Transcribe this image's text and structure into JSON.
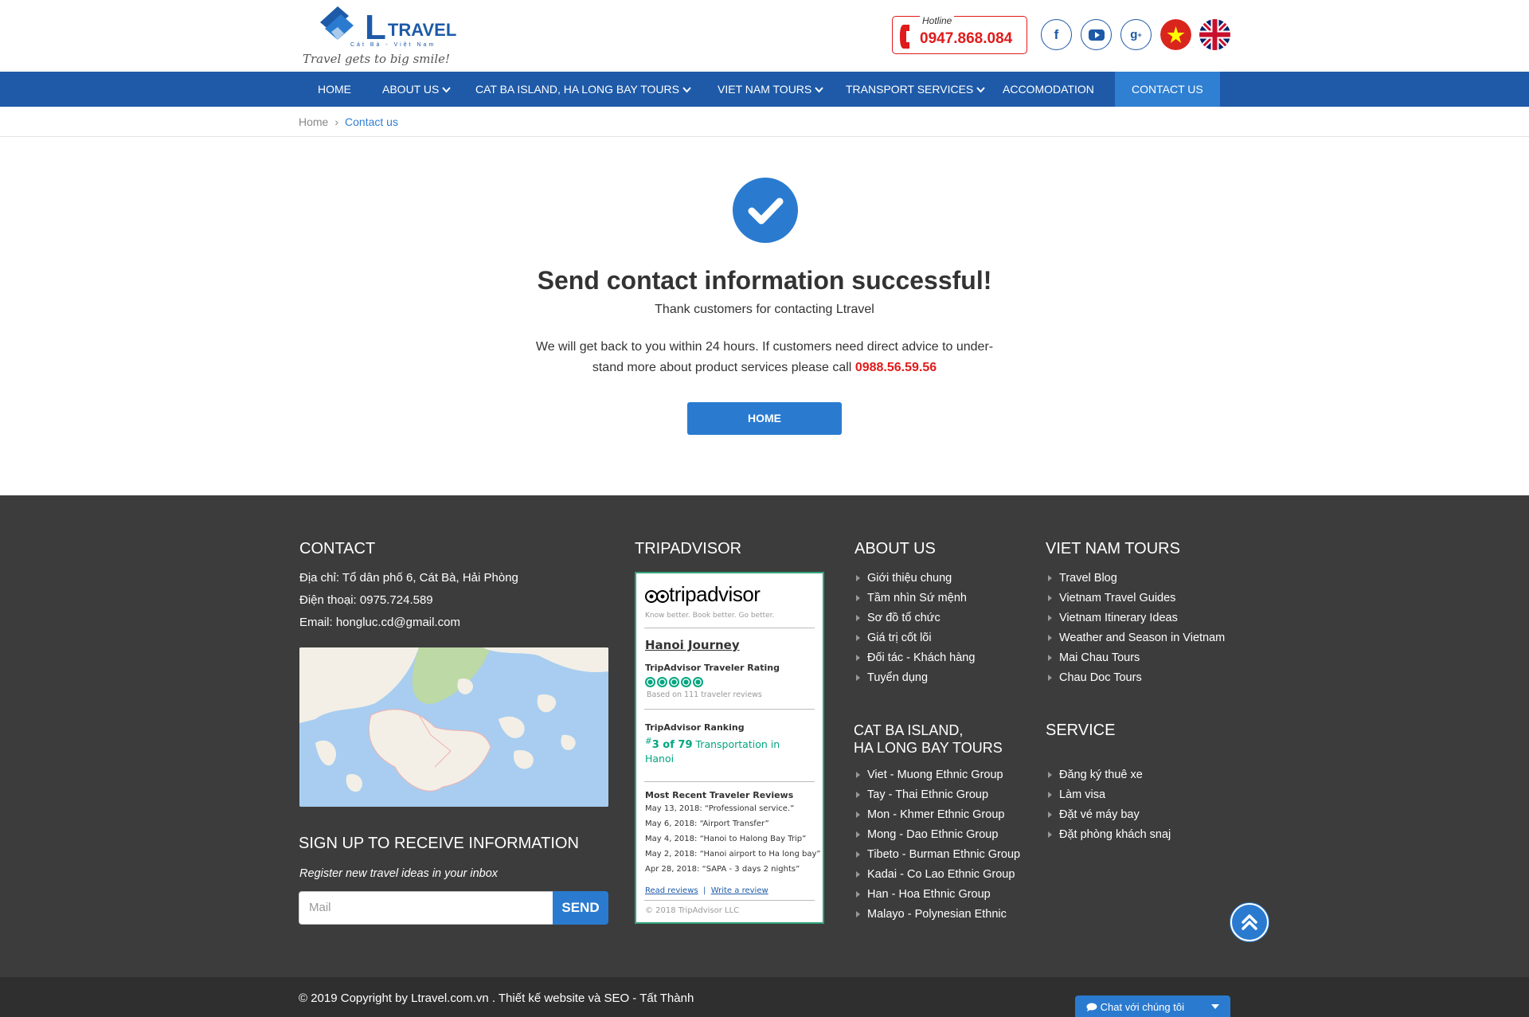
{
  "header": {
    "logo_letter": "L",
    "logo_word": "TRAVEL",
    "logo_sub": "Cát Bà - Việt Nam",
    "tagline": "Travel gets to big smile!",
    "hotline_label": "Hotline",
    "hotline_number": "0947.868.084",
    "social": [
      "facebook-icon",
      "youtube-icon",
      "google-plus-icon"
    ],
    "languages": [
      "vietnamese-flag-icon",
      "uk-flag-icon"
    ]
  },
  "nav": {
    "items": [
      {
        "label": "HOME",
        "has_dropdown": false
      },
      {
        "label": "ABOUT US",
        "has_dropdown": true
      },
      {
        "label": "CAT BA ISLAND, HA LONG BAY TOURS",
        "has_dropdown": true
      },
      {
        "label": "VIET NAM TOURS",
        "has_dropdown": true
      },
      {
        "label": "TRANSPORT SERVICES",
        "has_dropdown": true
      },
      {
        "label": "ACCOMODATION",
        "has_dropdown": false
      },
      {
        "label": "CONTACT US",
        "has_dropdown": false,
        "active": true
      }
    ]
  },
  "breadcrumb": {
    "home": "Home",
    "current": "Contact us"
  },
  "success": {
    "title": "Send contact information successful!",
    "thanks": "Thank customers for contacting Ltravel",
    "message_line1": "We will get back to you within 24 hours. If customers need direct advice to under-",
    "message_line2": "stand more about product services please call",
    "phone": "0988.56.59.56",
    "home_button": "HOME"
  },
  "footer": {
    "contact": {
      "heading": "CONTACT",
      "address": "Địa chỉ: Tổ dân phố 6, Cát Bà, Hải Phòng",
      "phone": "Điện thoại: 0975.724.589",
      "email": "Email: hongluc.cd@gmail.com"
    },
    "signup": {
      "heading": "SIGN UP TO RECEIVE INFORMATION",
      "subtitle": "Register new travel ideas in your inbox",
      "placeholder": "Mail",
      "button": "SEND"
    },
    "tripadvisor": {
      "heading": "TRIPADVISOR",
      "logo_trip": "trip",
      "logo_advisor": "advisor",
      "tagline": "Know better. Book better. Go better.",
      "name": "Hanoi Journey",
      "rating_title": "TripAdvisor Traveler Rating",
      "rating_value": 5,
      "rating_max": 5,
      "based_on": "Based on 111 traveler reviews",
      "ranking_title": "TripAdvisor Ranking",
      "ranking_text_bold": "3 of 79",
      "ranking_text_rest": "Transportation in Hanoi",
      "reviews_title": "Most Recent Traveler Reviews",
      "reviews": [
        "May 13, 2018: “Professional service.”",
        "May 6, 2018: “Airport Transfer”",
        "May 4, 2018: “Hanoi to Halong Bay Trip”",
        "May 2, 2018: “Hanoi airport to Ha long bay”",
        "Apr 28, 2018: “SAPA - 3 days 2 nights”"
      ],
      "read_reviews": "Read reviews",
      "write_review": "Write a review",
      "copyright": "© 2018 TripAdvisor LLC"
    },
    "about": {
      "heading": "ABOUT US",
      "items": [
        "Giới thiệu chung",
        "Tầm nhìn Sứ mệnh",
        "Sơ đồ tổ chức",
        "Giá trị cốt lõi",
        "Đối tác - Khách hàng",
        "Tuyển dụng"
      ]
    },
    "catba": {
      "heading_line1": "CAT BA ISLAND,",
      "heading_line2": "HA LONG BAY TOURS",
      "items": [
        "Viet - Muong Ethnic Group",
        "Tay - Thai Ethnic Group",
        "Mon - Khmer Ethnic Group",
        "Mong - Dao Ethnic Group",
        "Tibeto - Burman Ethnic Group",
        "Kadai - Co Lao Ethnic Group",
        "Han - Hoa Ethnic Group",
        "Malayo - Polynesian Ethnic"
      ]
    },
    "vntours": {
      "heading": "VIET NAM TOURS",
      "items": [
        "Travel Blog",
        "Vietnam Travel Guides",
        "Vietnam Itinerary Ideas",
        "Weather and Season in Vietnam",
        "Mai Chau Tours",
        "Chau Doc Tours"
      ]
    },
    "service": {
      "heading": "SERVICE",
      "items": [
        "Đăng ký thuê xe",
        "Làm visa",
        "Đặt vé máy bay",
        "Đặt phòng khách snaj"
      ]
    },
    "copyright": "© 2019 Copyright by Ltravel.com.vn . Thiết kế website và SEO - Tất Thành",
    "chat_label": "Chat với chúng tôi"
  },
  "colors": {
    "primary": "#1e5aa8",
    "accent": "#2a7bd0",
    "hotline_red": "#e01b1b",
    "footer_bg": "#3c3c3c",
    "tripadvisor_green": "#00a680"
  }
}
